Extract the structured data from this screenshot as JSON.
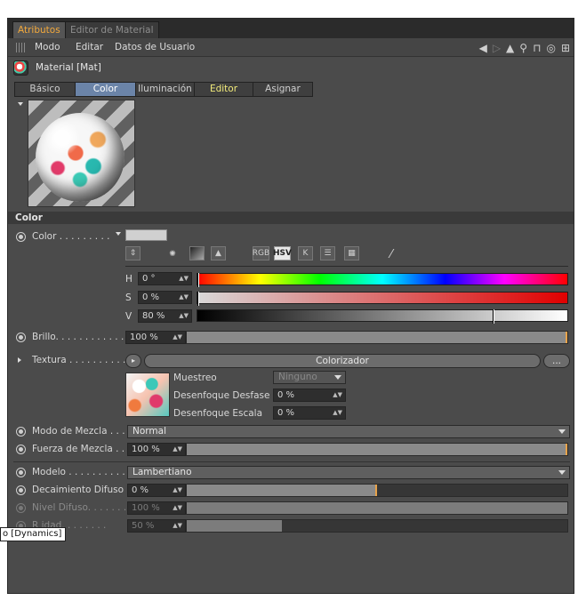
{
  "tabs": {
    "active": "Atributos",
    "inactive": "Editor de Material"
  },
  "menu": {
    "items": [
      "Modo",
      "Editar",
      "Datos de Usuario"
    ]
  },
  "object": {
    "title": "Material [Mat]"
  },
  "subtabs": [
    "Básico",
    "Color",
    "Iluminación",
    "Editor",
    "Asignar"
  ],
  "section": {
    "title": "Color"
  },
  "color": {
    "label": "Color . . . . . . . . .",
    "tools": {
      "rgb": "RGB",
      "hsv": "HSV",
      "k": "K"
    },
    "h": {
      "label": "H",
      "value": "0 °"
    },
    "s": {
      "label": "S",
      "value": "0 %"
    },
    "v": {
      "label": "V",
      "value": "80 %",
      "level": 0.8
    }
  },
  "brillo": {
    "label": "Brillo. . . . . . . . . . . . .",
    "value": "100 %",
    "level": 1.0
  },
  "textura": {
    "label": "Textura . . . . . . . . . .",
    "button": "Colorizador",
    "more": "...",
    "muestreo": {
      "label": "Muestreo",
      "value": "Ninguno"
    },
    "desfase": {
      "label": "Desenfoque Desfase",
      "value": "0 %"
    },
    "escala": {
      "label": "Desenfoque Escala",
      "value": "0 %"
    }
  },
  "modo_mezcla": {
    "label": "Modo de Mezcla . . .",
    "value": "Normal"
  },
  "fuerza_mezcla": {
    "label": "Fuerza de Mezcla . .",
    "value": "100 %",
    "level": 1.0
  },
  "modelo": {
    "label": "Modelo . . . . . . . . . . .",
    "value": "Lambertiano"
  },
  "decaimiento": {
    "label": "Decaimiento Difuso",
    "value": "0 %",
    "level": 0.5
  },
  "nivel": {
    "label": "Nivel Difuso. . . . . . .",
    "value": "100 %"
  },
  "rugosidad": {
    "label": "R       idad. . . . . . . .",
    "value": "50 %",
    "level": 0.25
  },
  "tooltip": "o [Dynamics]",
  "colors": {
    "accent": "#f3a93c",
    "selected_tab": "#6b84a8",
    "panel": "#4b4b4b"
  }
}
